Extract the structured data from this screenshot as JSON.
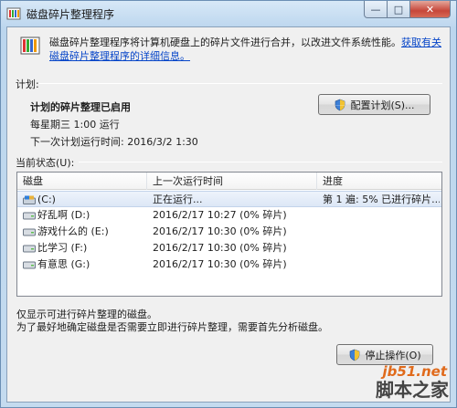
{
  "window": {
    "title": "磁盘碎片整理程序",
    "minimize_glyph": "—",
    "maximize_glyph": "□",
    "close_glyph": "✕",
    "app_icon": "disk-defragmenter-icon"
  },
  "intro": {
    "text": "磁盘碎片整理程序将计算机硬盘上的碎片文件进行合并，以改进文件系统性能。",
    "link": "获取有关磁盘碎片整理程序的详细信息。"
  },
  "schedule": {
    "group_label": "计划:",
    "status": "计划的碎片整理已启用",
    "run_time": "每星期三  1:00 运行",
    "next_run": "下一次计划运行时间: 2016/3/2 1:30",
    "configure_button": "配置计划(S)..."
  },
  "current_status": {
    "group_label": "当前状态(U):",
    "columns": [
      "磁盘",
      "上一次运行时间",
      "进度"
    ],
    "rows": [
      {
        "disk": "(C:)",
        "last_run": "正在运行...",
        "progress": "第 1 遍: 5% 已进行碎片..."
      },
      {
        "disk": "好乱啊 (D:)",
        "last_run": "2016/2/17 10:27 (0% 碎片)",
        "progress": ""
      },
      {
        "disk": "游戏什么的 (E:)",
        "last_run": "2016/2/17 10:30 (0% 碎片)",
        "progress": ""
      },
      {
        "disk": "比学习 (F:)",
        "last_run": "2016/2/17 10:30 (0% 碎片)",
        "progress": ""
      },
      {
        "disk": "有意思 (G:)",
        "last_run": "2016/2/17 10:30 (0% 碎片)",
        "progress": ""
      }
    ]
  },
  "footer": {
    "line1": "仅显示可进行碎片整理的磁盘。",
    "line2": "为了最好地确定磁盘是否需要立即进行碎片整理，需要首先分析磁盘。",
    "stop_button": "停止操作(O)"
  },
  "watermark": {
    "site": "jb51.net",
    "name": "脚本之家"
  },
  "colors": {
    "link": "#0645c8",
    "selected_row": "#dce7f6"
  }
}
